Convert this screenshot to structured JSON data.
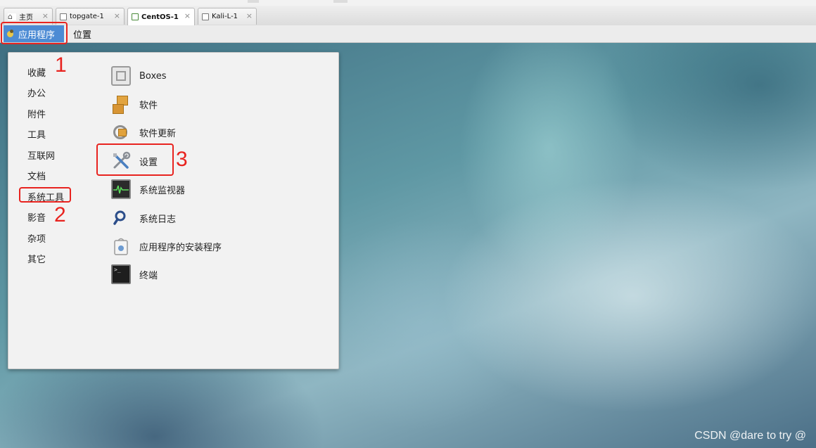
{
  "tabs": [
    {
      "label": "主页",
      "icon": "home-icon",
      "active": false
    },
    {
      "label": "topgate-1",
      "icon": "vm-icon",
      "active": false
    },
    {
      "label": "CentOS-1",
      "icon": "vm-running-icon",
      "active": true
    },
    {
      "label": "Kali-L-1",
      "icon": "vm-icon",
      "active": false
    }
  ],
  "tab_close_glyph": "×",
  "panel": {
    "applications_label": "应用程序",
    "places_label": "位置"
  },
  "menu": {
    "categories": [
      "收藏",
      "办公",
      "附件",
      "工具",
      "互联网",
      "文档",
      "系统工具",
      "影音",
      "杂项",
      "其它"
    ],
    "entries": [
      {
        "label": "Boxes",
        "icon": "boxes-icon"
      },
      {
        "label": "软件",
        "icon": "software-icon"
      },
      {
        "label": "软件更新",
        "icon": "software-update-icon"
      },
      {
        "label": "设置",
        "icon": "settings-tools-icon"
      },
      {
        "label": "系统监视器",
        "icon": "system-monitor-icon"
      },
      {
        "label": "系统日志",
        "icon": "system-log-icon"
      },
      {
        "label": "应用程序的安装程序",
        "icon": "application-installer-icon"
      },
      {
        "label": "终端",
        "icon": "terminal-icon"
      }
    ]
  },
  "annotations": [
    "1",
    "2",
    "3"
  ],
  "watermark": "CSDN @dare to try @",
  "colors": {
    "highlight": "#4c8bd4",
    "annotation_red": "#e8231f",
    "menu_bg": "#f2f2f2"
  }
}
